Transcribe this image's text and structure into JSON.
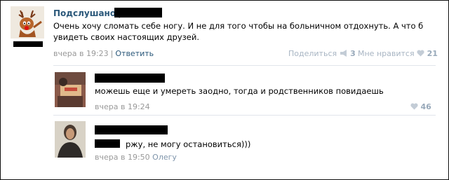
{
  "post": {
    "author": "Подслушано",
    "separator": "|",
    "text": "Очень хочу сломать себе ногу. И не для того чтобы на больничном отдохнуть. А что б увидеть своих настоящих друзей.",
    "time": "вчера в 19:23",
    "reply_label": "Ответить",
    "share_label": "Поделиться",
    "share_count": "3",
    "like_label": "Мне нравится",
    "like_count": "21"
  },
  "comments": [
    {
      "text": "можешь еще и умереть заодно, тогда и родственников повидаешь",
      "time": "вчера в 19:24",
      "like_count": "46"
    },
    {
      "text": "ржу, не могу остановиться)))",
      "time": "вчера в 19:50",
      "reply_to": "Олегу"
    }
  ],
  "icons": {
    "avatar_main": "deer-avatar",
    "share": "megaphone-icon",
    "like": "heart-icon"
  },
  "colors": {
    "link": "#2b587a",
    "muted": "#999999",
    "stat": "#a8b5c3",
    "redaction": "#000000"
  }
}
